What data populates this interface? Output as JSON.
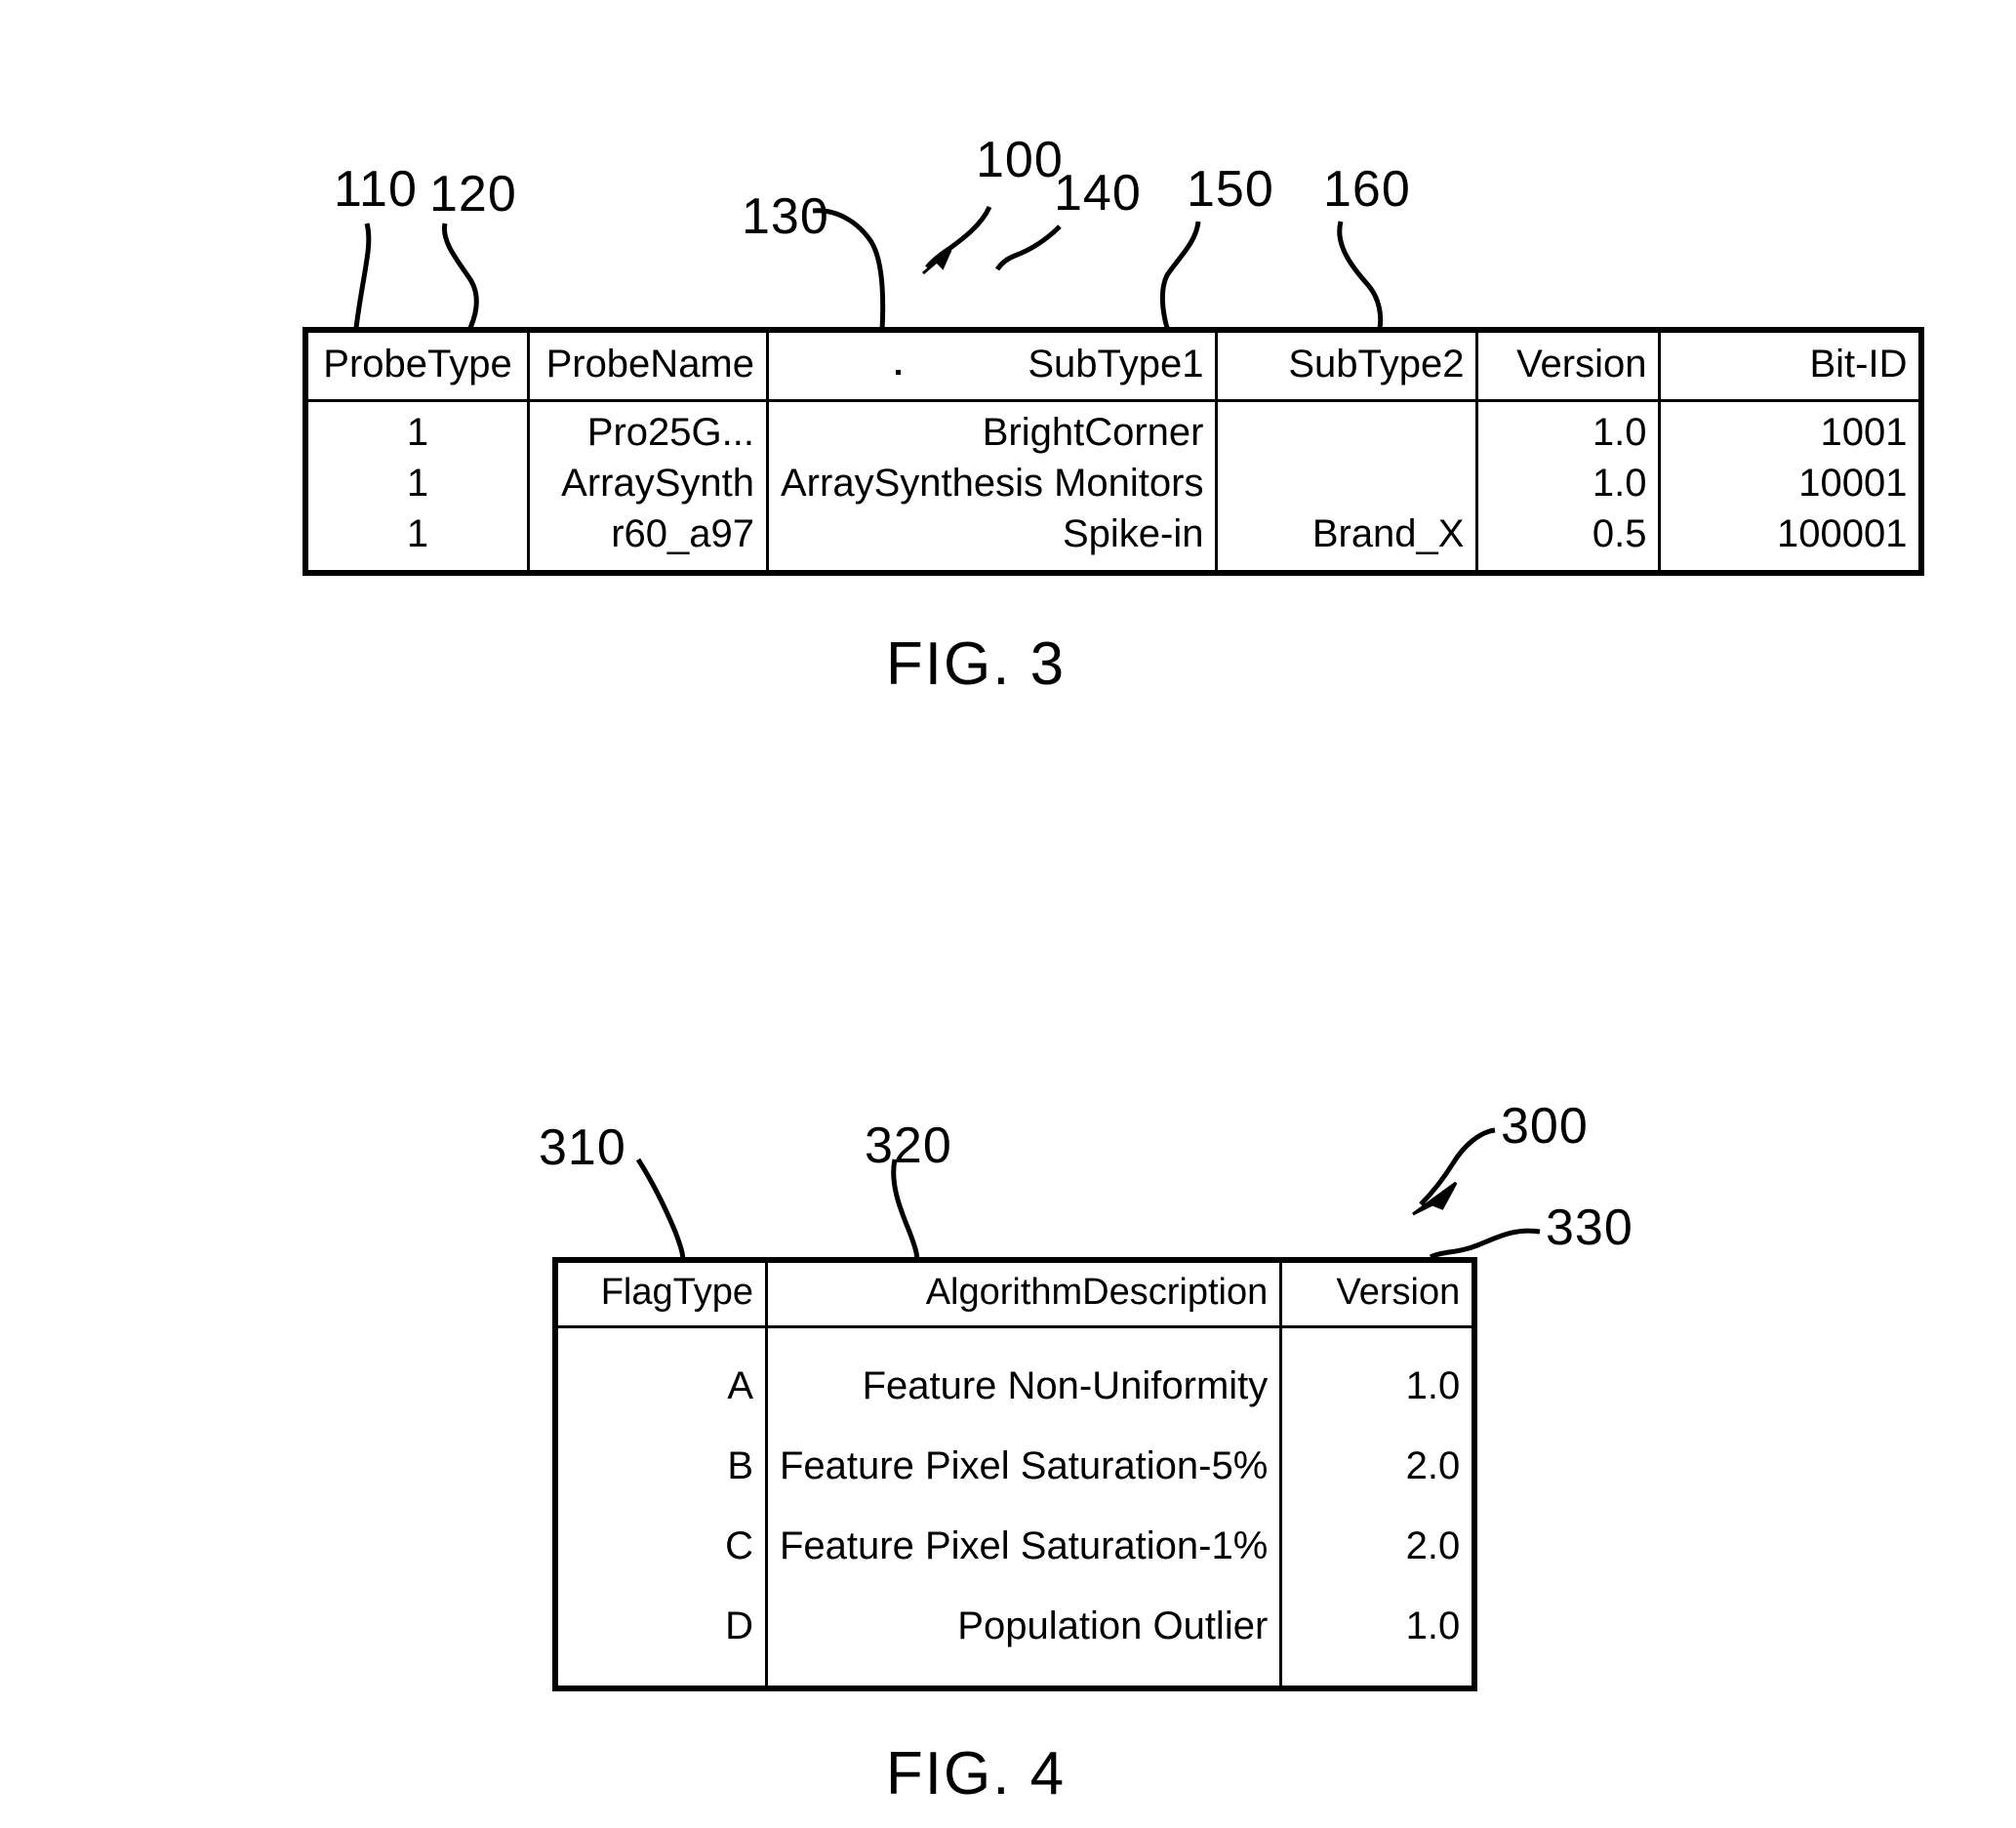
{
  "document": {
    "kind": "patent-drawing-sheet"
  },
  "figures": [
    {
      "id": "fig3",
      "caption": "FIG. 3",
      "table_ref": "100",
      "table": {
        "columns": [
          {
            "ref": "110",
            "label": "ProbeType"
          },
          {
            "ref": "120",
            "label": "ProbeName"
          },
          {
            "ref": "130",
            "label": "SubType1"
          },
          {
            "ref": "140",
            "label": "SubType2"
          },
          {
            "ref": "150",
            "label": "Version"
          },
          {
            "ref": "160",
            "label": "Bit-ID"
          }
        ],
        "rows": [
          {
            "probetype": "1",
            "probename": "Pro25G...",
            "subtype1": "BrightCorner",
            "subtype2": "",
            "version": "1.0",
            "bitid": "1001"
          },
          {
            "probetype": "1",
            "probename": "ArraySynth",
            "subtype1": "ArraySynthesis Monitors",
            "subtype2": "",
            "version": "1.0",
            "bitid": "10001"
          },
          {
            "probetype": "1",
            "probename": "r60_a97",
            "subtype1": "Spike-in",
            "subtype2": "Brand_X",
            "version": "0.5",
            "bitid": "100001"
          }
        ]
      }
    },
    {
      "id": "fig4",
      "caption": "FIG. 4",
      "table_ref": "300",
      "table": {
        "columns": [
          {
            "ref": "310",
            "label": "FlagType"
          },
          {
            "ref": "320",
            "label": "AlgorithmDescription"
          },
          {
            "ref": "330",
            "label": "Version"
          }
        ],
        "rows": [
          {
            "flagtype": "A",
            "algodesc": "Feature Non-Uniformity",
            "version": "1.0"
          },
          {
            "flagtype": "B",
            "algodesc": "Feature Pixel Saturation-5%",
            "version": "2.0"
          },
          {
            "flagtype": "C",
            "algodesc": "Feature Pixel Saturation-1%",
            "version": "2.0"
          },
          {
            "flagtype": "D",
            "algodesc": "Population Outlier",
            "version": "1.0"
          }
        ]
      }
    }
  ],
  "reference_numerals": {
    "n110": "110",
    "n120": "120",
    "n130": "130",
    "n100": "100",
    "n140": "140",
    "n150": "150",
    "n160": "160",
    "n310": "310",
    "n320": "320",
    "n300": "300",
    "n330": "330"
  },
  "colors": {
    "ink": "#000000",
    "paper": "#ffffff"
  }
}
